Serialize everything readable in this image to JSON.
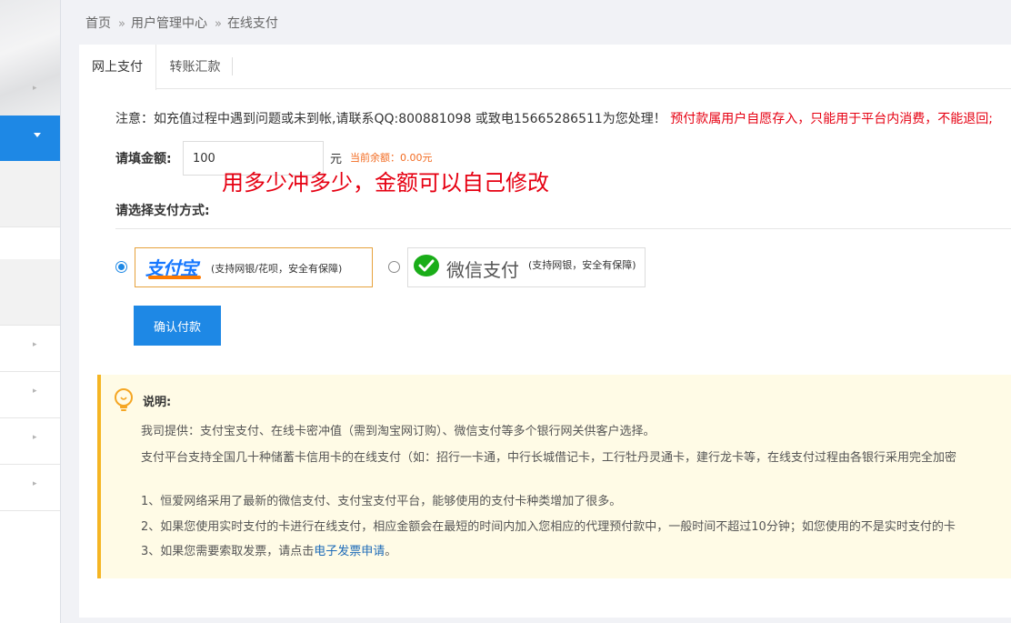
{
  "breadcrumb": {
    "home": "首页",
    "sep": "»",
    "level2": "用户管理中心",
    "current": "在线支付"
  },
  "tabs": {
    "online_pay": "网上支付",
    "transfer": "转账汇款"
  },
  "notice": {
    "prefix": "注意：如充值过程中遇到问题或未到帐,请联系QQ:800881098 或致电15665286511为您处理！",
    "warning": "预付款属用户自愿存入，只能用于平台内消费，不能退回;"
  },
  "form": {
    "amount_label": "请填金额:",
    "amount_value": "100",
    "unit": "元",
    "balance": "当前余额：0.00元",
    "annotation": "用多少冲多少，金额可以自己修改",
    "method_label": "请选择支付方式:"
  },
  "payment": {
    "alipay_logo": "支付宝",
    "alipay_note": "(支持网银/花呗，安全有保障)",
    "wechat_name": "微信支付",
    "wechat_note": "(支持网银，安全有保障)",
    "selected": "alipay"
  },
  "confirm_label": "确认付款",
  "info": {
    "title": "说明:",
    "line1": "我司提供：支付宝支付、在线卡密冲值（需到淘宝网订购）、微信支付等多个银行网关供客户选择。",
    "line2": "支付平台支持全国几十种储蓄卡信用卡的在线支付（如：招行一卡通，中行长城借记卡，工行牡丹灵通卡，建行龙卡等，在线支付过程由各银行采用完全加密",
    "item1": "1、恒爱网络采用了最新的微信支付、支付宝支付平台，能够使用的支付卡种类增加了很多。",
    "item2": "2、如果您使用实时支付的卡进行在线支付，相应金额会在最短的时间内加入您相应的代理预付款中，一般时间不超过10分钟；如您使用的不是实时支付的卡",
    "item3_prefix": "3、如果您需要索取发票，请点击",
    "item3_link": "电子发票申请",
    "item3_suffix": "。"
  },
  "colors": {
    "primary": "#1e88e5",
    "warning_red": "#e60012",
    "balance_orange": "#f26b21",
    "info_border": "#f5b523",
    "info_bg": "#fffbe6"
  },
  "icons": [
    "chevron-right-icon",
    "caret-down-icon",
    "alipay-logo",
    "wechat-icon",
    "lightbulb-icon"
  ]
}
